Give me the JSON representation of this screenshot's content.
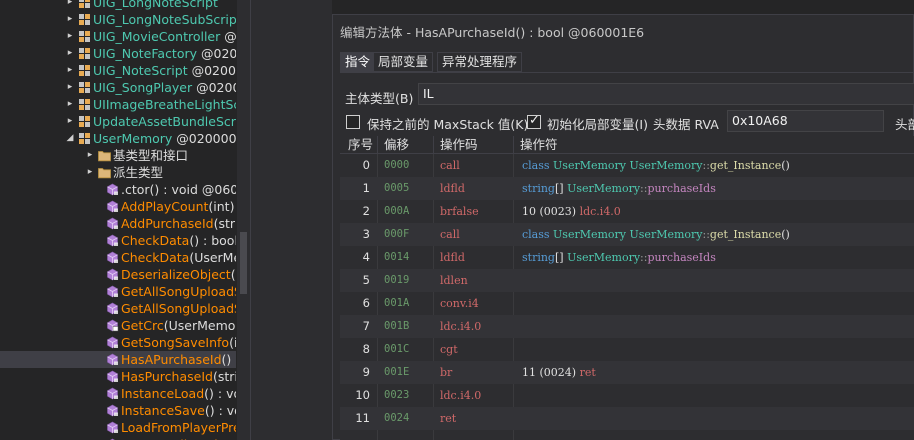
{
  "tree": {
    "items": [
      {
        "toggle": "▸",
        "icon": "class",
        "name": "UIG_LongNoteScript",
        "addr": "",
        "kind": "class"
      },
      {
        "toggle": "▸",
        "icon": "class",
        "name": "UIG_LongNoteSubScrip",
        "addr": "",
        "kind": "class"
      },
      {
        "toggle": "▸",
        "icon": "class",
        "name": "UIG_MovieController",
        "addr": "@0200",
        "kind": "class"
      },
      {
        "toggle": "▸",
        "icon": "class",
        "name": "UIG_NoteFactory",
        "addr": "@020",
        "kind": "class"
      },
      {
        "toggle": "▸",
        "icon": "class",
        "name": "UIG_NoteScript",
        "addr": "@0200",
        "kind": "class"
      },
      {
        "toggle": "▸",
        "icon": "class",
        "name": "UIG_SongPlayer",
        "addr": "@0200",
        "kind": "class"
      },
      {
        "toggle": "▸",
        "icon": "class",
        "name": "UIImageBreatheLightSc",
        "addr": "",
        "kind": "class"
      },
      {
        "toggle": "▸",
        "icon": "class",
        "name": "UpdateAssetBundleScri",
        "addr": "",
        "kind": "class"
      },
      {
        "toggle": "◢",
        "icon": "class",
        "name": "UserMemory",
        "addr": "@020000",
        "kind": "class"
      },
      {
        "toggle": "▸",
        "icon": "folder",
        "name": "基类型和接口",
        "addr": "",
        "kind": "folder"
      },
      {
        "toggle": "▸",
        "icon": "folder",
        "name": "派生类型",
        "addr": "",
        "kind": "folder"
      },
      {
        "toggle": "",
        "icon": "method",
        "name": ".ctor",
        "addr": "() : void @06000",
        "kind": "ctor"
      },
      {
        "toggle": "",
        "icon": "method",
        "name": "AddPlayCount",
        "addr": "(int) : v",
        "kind": "method"
      },
      {
        "toggle": "",
        "icon": "method",
        "name": "AddPurchaseId",
        "addr": "(strin",
        "kind": "method"
      },
      {
        "toggle": "",
        "icon": "method",
        "name": "CheckData",
        "addr": "() : bool @",
        "kind": "method"
      },
      {
        "toggle": "",
        "icon": "method",
        "name": "CheckData",
        "addr": "(UserMer",
        "kind": "method"
      },
      {
        "toggle": "",
        "icon": "method",
        "name": "DeserializeObject",
        "addr": "(by",
        "kind": "method"
      },
      {
        "toggle": "",
        "icon": "method",
        "name": "GetAllSongUploadSc",
        "addr": "",
        "kind": "method"
      },
      {
        "toggle": "",
        "icon": "method",
        "name": "GetAllSongUploadSc",
        "addr": "",
        "kind": "method"
      },
      {
        "toggle": "",
        "icon": "method-lock",
        "name": "GetCrc",
        "addr": "(UserMemory",
        "kind": "method"
      },
      {
        "toggle": "",
        "icon": "method",
        "name": "GetSongSaveInfo",
        "addr": "(int",
        "kind": "method"
      },
      {
        "toggle": "",
        "icon": "method",
        "name": "HasAPurchaseId",
        "addr": "() : b",
        "kind": "method",
        "selected": true
      },
      {
        "toggle": "",
        "icon": "method",
        "name": "HasPurchaseId",
        "addr": "(strin",
        "kind": "method"
      },
      {
        "toggle": "",
        "icon": "method",
        "name": "InstanceLoad",
        "addr": "() : void",
        "kind": "method"
      },
      {
        "toggle": "",
        "icon": "method",
        "name": "InstanceSave",
        "addr": "() : voic",
        "kind": "method"
      },
      {
        "toggle": "",
        "icon": "method",
        "name": "LoadFromPlayerPref",
        "addr": "",
        "kind": "method"
      },
      {
        "toggle": "",
        "icon": "method",
        "name": "RemoveAllPurchase",
        "addr": "",
        "kind": "method"
      }
    ]
  },
  "dialog": {
    "title": "编辑方法体 - HasAPurchaseId() : bool @060001E6",
    "tabs": [
      "指令",
      "局部变量",
      "异常处理程序"
    ],
    "body_type_label": "主体类型(B)",
    "body_type_value": "IL",
    "keep_maxstack_label": "保持之前的 MaxStack 值(K)",
    "keep_maxstack_checked": false,
    "init_locals_label": "初始化局部变量(I)",
    "init_locals_checked": true,
    "header_rva_label": "头数据 RVA",
    "header_rva_value": "0x10A68",
    "header_extra_label": "头部"
  },
  "grid": {
    "columns": [
      "序号",
      "偏移",
      "操作码",
      "操作符"
    ],
    "rows": [
      {
        "idx": "0",
        "offset": "0000",
        "opcode": "call",
        "operand": [
          [
            "a-kw",
            "class "
          ],
          [
            "a-cls",
            "UserMemory "
          ],
          [
            "a-cls",
            "UserMemory"
          ],
          [
            "a-pun",
            "::"
          ],
          [
            "a-meth",
            "get_Instance"
          ],
          [
            "a-num",
            "()"
          ]
        ]
      },
      {
        "idx": "1",
        "offset": "0005",
        "opcode": "ldfld",
        "operand": [
          [
            "a-kw",
            "string"
          ],
          [
            "a-num",
            "[] "
          ],
          [
            "a-cls",
            "UserMemory"
          ],
          [
            "a-pun",
            "::"
          ],
          [
            "a-fld",
            "purchaseIds"
          ]
        ]
      },
      {
        "idx": "2",
        "offset": "000A",
        "opcode": "brfalse",
        "operand": [
          [
            "a-num",
            "10 (0023) "
          ],
          [
            "a-op",
            "ldc.i4.0"
          ]
        ]
      },
      {
        "idx": "3",
        "offset": "000F",
        "opcode": "call",
        "operand": [
          [
            "a-kw",
            "class "
          ],
          [
            "a-cls",
            "UserMemory "
          ],
          [
            "a-cls",
            "UserMemory"
          ],
          [
            "a-pun",
            "::"
          ],
          [
            "a-meth",
            "get_Instance"
          ],
          [
            "a-num",
            "()"
          ]
        ]
      },
      {
        "idx": "4",
        "offset": "0014",
        "opcode": "ldfld",
        "operand": [
          [
            "a-kw",
            "string"
          ],
          [
            "a-num",
            "[] "
          ],
          [
            "a-cls",
            "UserMemory"
          ],
          [
            "a-pun",
            "::"
          ],
          [
            "a-fld",
            "purchaseIds"
          ]
        ]
      },
      {
        "idx": "5",
        "offset": "0019",
        "opcode": "ldlen",
        "operand": []
      },
      {
        "idx": "6",
        "offset": "001A",
        "opcode": "conv.i4",
        "operand": []
      },
      {
        "idx": "7",
        "offset": "001B",
        "opcode": "ldc.i4.0",
        "operand": []
      },
      {
        "idx": "8",
        "offset": "001C",
        "opcode": "cgt",
        "operand": []
      },
      {
        "idx": "9",
        "offset": "001E",
        "opcode": "br",
        "operand": [
          [
            "a-num",
            "11 (0024) "
          ],
          [
            "a-op",
            "ret"
          ]
        ]
      },
      {
        "idx": "10",
        "offset": "0023",
        "opcode": "ldc.i4.0",
        "operand": []
      },
      {
        "idx": "11",
        "offset": "0024",
        "opcode": "ret",
        "operand": []
      }
    ]
  },
  "colors": {
    "background": "#252526",
    "class_text": "#4ec9b0",
    "method_text": "#ff8c00",
    "opcode_text": "#d16969",
    "keyword_text": "#569cd6"
  }
}
